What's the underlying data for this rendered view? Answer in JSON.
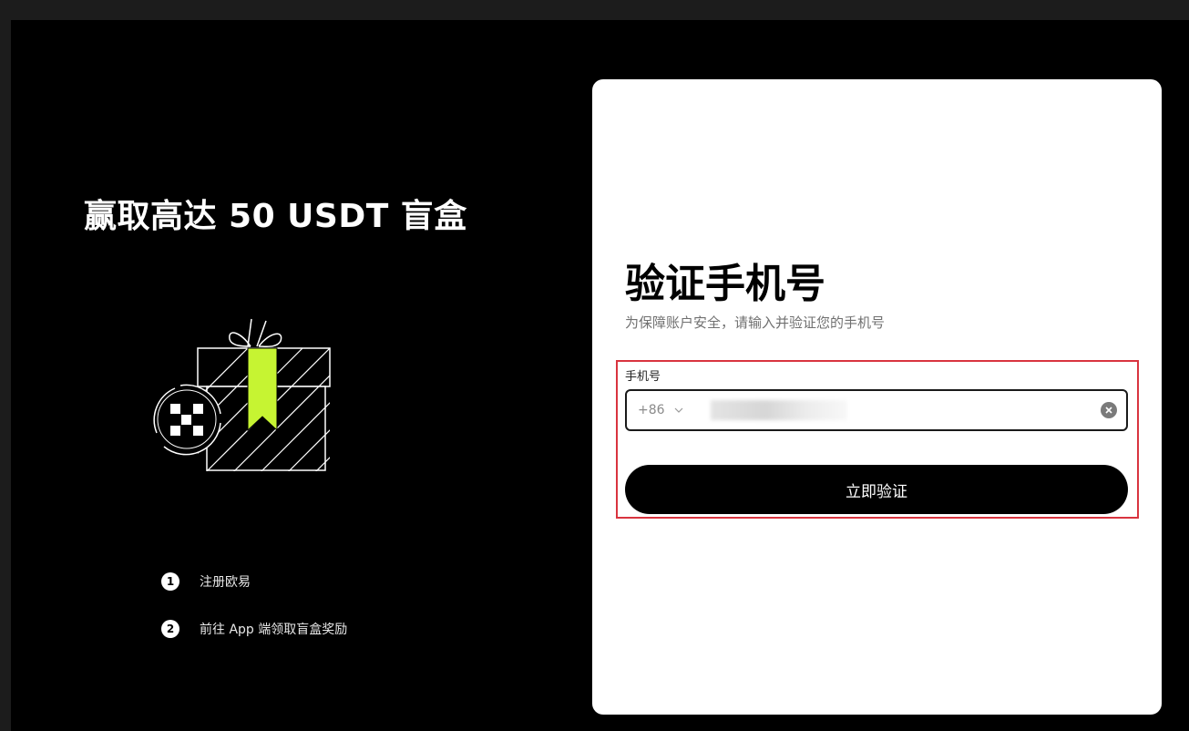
{
  "promo": {
    "title": "赢取高达 50 USDT 盲盒",
    "steps": [
      {
        "num": "1",
        "label": "注册欧易"
      },
      {
        "num": "2",
        "label": "前往 App 端领取盲盒奖励"
      }
    ],
    "accent_color": "#c6f432",
    "gift_icon": "gift-box-icon",
    "logo_icon": "okx-logo-icon"
  },
  "verify": {
    "title": "验证手机号",
    "subtitle": "为保障账户安全，请输入并验证您的手机号",
    "field_label": "手机号",
    "country_code": "+86",
    "phone_value": "",
    "submit_label": "立即验证",
    "highlight_color": "#d9343f"
  }
}
